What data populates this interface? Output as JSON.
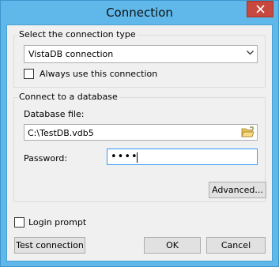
{
  "window": {
    "title": "Connection"
  },
  "connection_type": {
    "legend": "Select the connection type",
    "selected": "VistaDB connection",
    "always_use_label": "Always use this connection",
    "always_use_checked": false
  },
  "database": {
    "legend": "Connect to a database",
    "file_label": "Database file:",
    "file_value": "C:\\TestDB.vdb5",
    "password_label": "Password:",
    "password_mask": "••••"
  },
  "buttons": {
    "advanced": "Advanced...",
    "test_connection": "Test connection",
    "ok": "OK",
    "cancel": "Cancel"
  },
  "login_prompt": {
    "label": "Login prompt",
    "checked": false
  },
  "icons": [
    "close-icon",
    "dropdown-arrow-icon",
    "folder-open-icon"
  ]
}
